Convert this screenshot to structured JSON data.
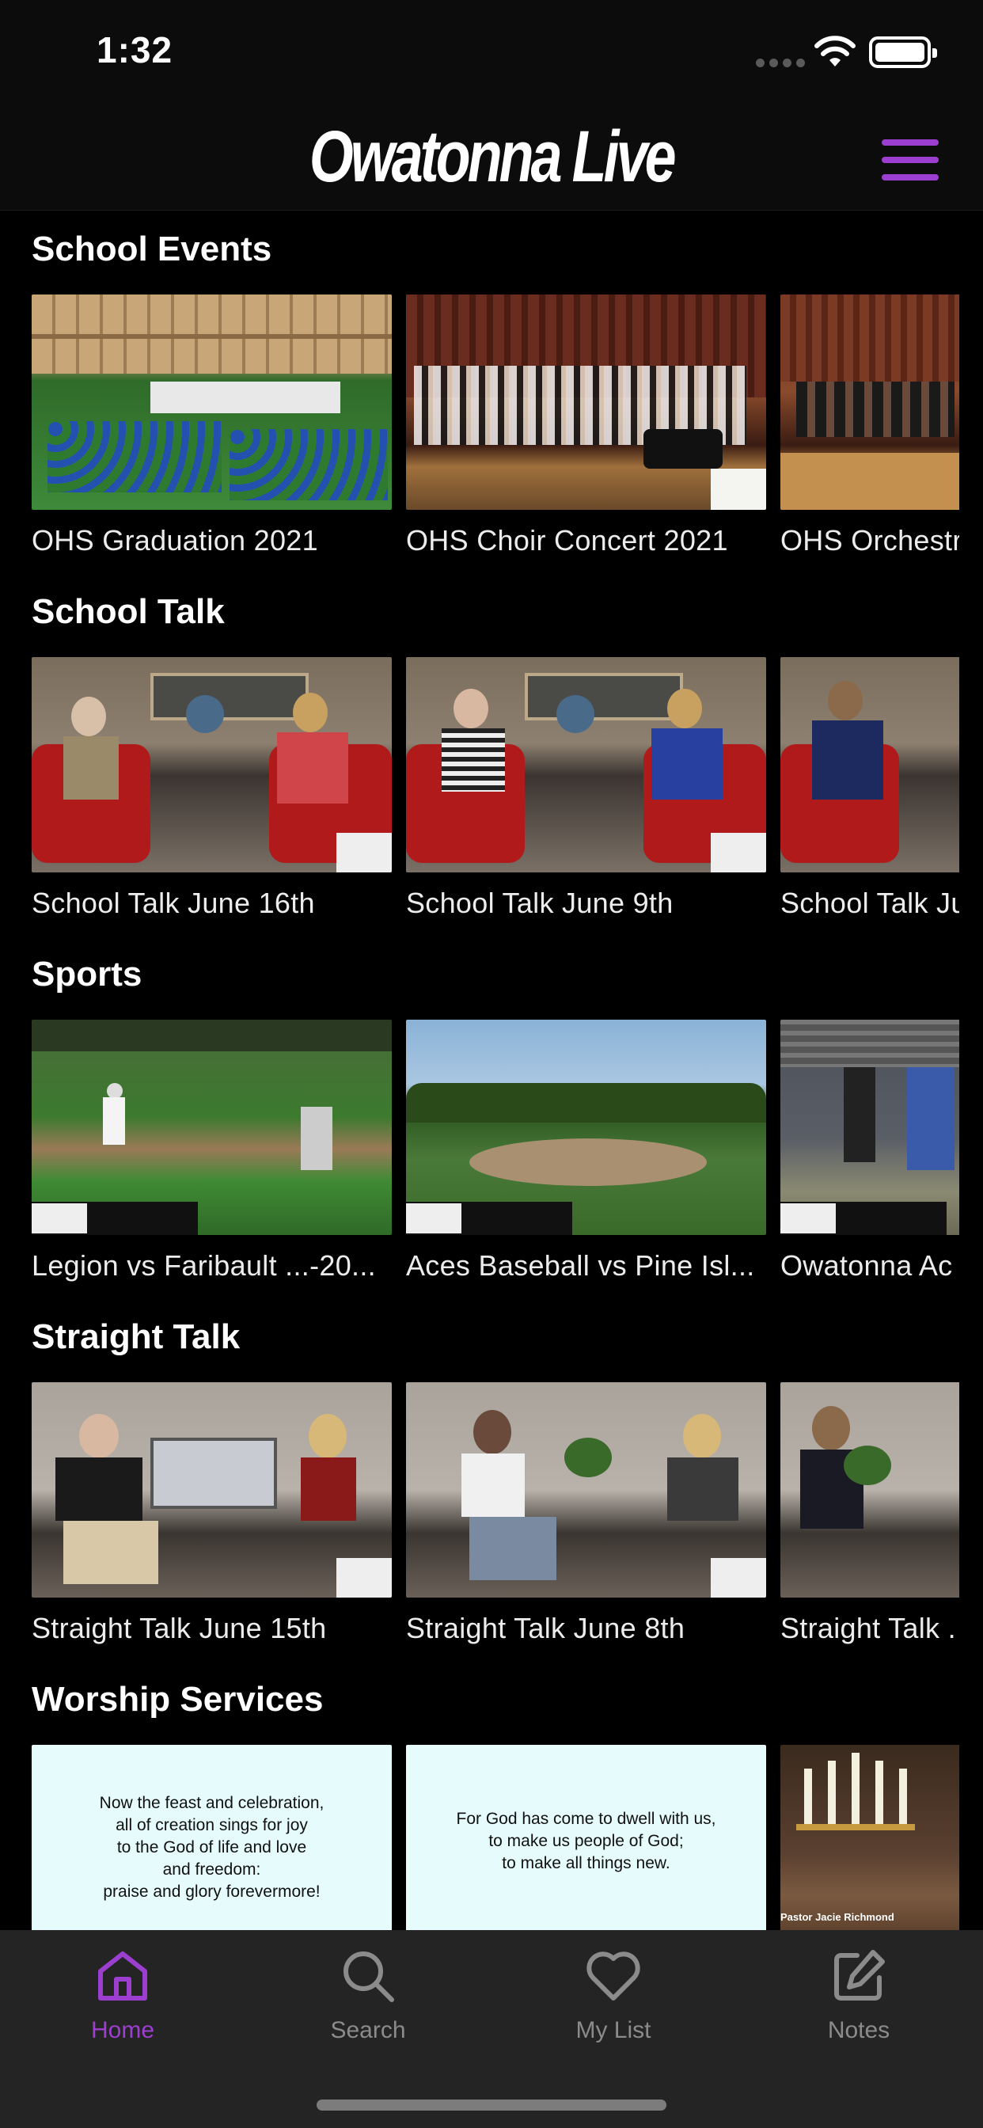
{
  "status_bar": {
    "time": "1:32"
  },
  "header": {
    "logo_text": "Owatonna Live",
    "menu_icon": "hamburger-menu-icon"
  },
  "sections": [
    {
      "title": "School Events",
      "items": [
        {
          "title": "OHS Graduation 2021"
        },
        {
          "title": "OHS Choir Concert 2021"
        },
        {
          "title": "OHS Orchestr"
        }
      ]
    },
    {
      "title": "School Talk",
      "items": [
        {
          "title": "School Talk June 16th"
        },
        {
          "title": "School Talk June 9th"
        },
        {
          "title": "School Talk Ju"
        }
      ]
    },
    {
      "title": "Sports",
      "items": [
        {
          "title": "Legion vs Faribault ...-20..."
        },
        {
          "title": "Aces Baseball vs Pine Isl..."
        },
        {
          "title": "Owatonna Ac"
        }
      ]
    },
    {
      "title": "Straight Talk",
      "items": [
        {
          "title": "Straight Talk June 15th"
        },
        {
          "title": "Straight Talk June 8th"
        },
        {
          "title": "Straight Talk ."
        }
      ]
    },
    {
      "title": "Worship Services",
      "items": [
        {
          "lines": [
            "Now the feast and celebration,",
            "all of creation sings for joy",
            "to the God of life and love",
            "and freedom:",
            "praise and glory forevermore!"
          ]
        },
        {
          "lines": [
            "For God has come to dwell with us,",
            "to make us people of God;",
            "to make all things new."
          ]
        },
        {
          "caption": "Pastor Jacie Richmond"
        }
      ]
    }
  ],
  "tabs": [
    {
      "label": "Home",
      "icon": "home-icon",
      "active": true
    },
    {
      "label": "Search",
      "icon": "search-icon",
      "active": false
    },
    {
      "label": "My List",
      "icon": "heart-icon",
      "active": false
    },
    {
      "label": "Notes",
      "icon": "notes-edit-icon",
      "active": false
    }
  ],
  "colors": {
    "accent": "#9c3fd1",
    "background": "#000000",
    "tab_bar": "#242424",
    "inactive_tab": "#8b8b8b"
  }
}
